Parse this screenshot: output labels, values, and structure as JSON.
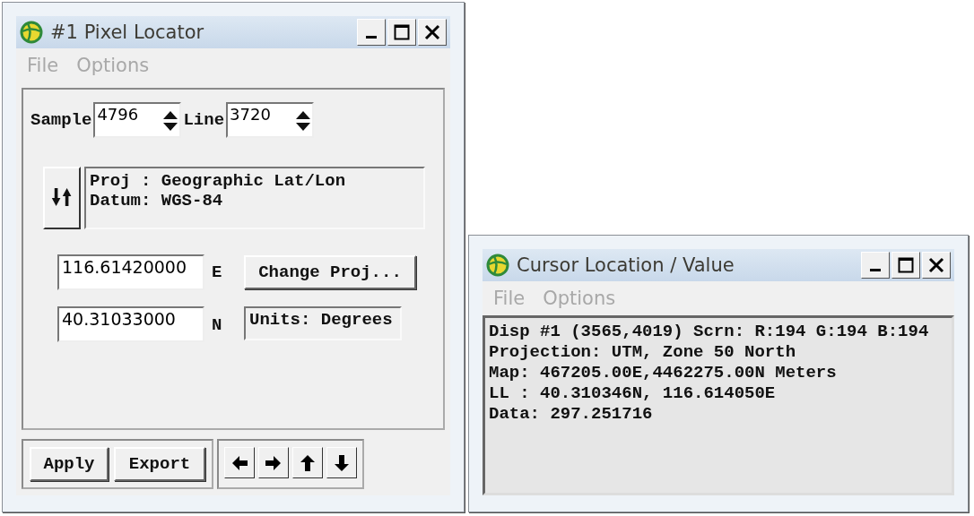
{
  "pixel_locator": {
    "title": "#1 Pixel Locator",
    "menu": [
      {
        "label": "File",
        "disabled": true
      },
      {
        "label": "Options",
        "disabled": true
      }
    ],
    "sample": {
      "label": "Sample",
      "value": "4796"
    },
    "line": {
      "label": "Line",
      "value": "3720"
    },
    "projection_info": [
      "Proj : Geographic Lat/Lon",
      "Datum: WGS-84"
    ],
    "easting": {
      "value": "116.61420000",
      "suffix": "E"
    },
    "northing": {
      "value": "40.31033000",
      "suffix": "N"
    },
    "change_button": "Change Proj...",
    "units": "Units: Degrees",
    "buttons": [
      "Apply",
      "Export"
    ]
  },
  "cursor_window": {
    "title": "Cursor Location / Value",
    "menu": [
      {
        "label": "File",
        "disabled": true
      },
      {
        "label": "Options",
        "disabled": true
      }
    ],
    "lines": [
      "Disp #1 (3565,4019) Scrn: R:194 G:194 B:194",
      "Projection: UTM, Zone 50 North",
      "Map: 467205.00E,4462275.00N Meters",
      "LL : 40.310346N, 116.614050E",
      "Data: 297.251716"
    ]
  }
}
